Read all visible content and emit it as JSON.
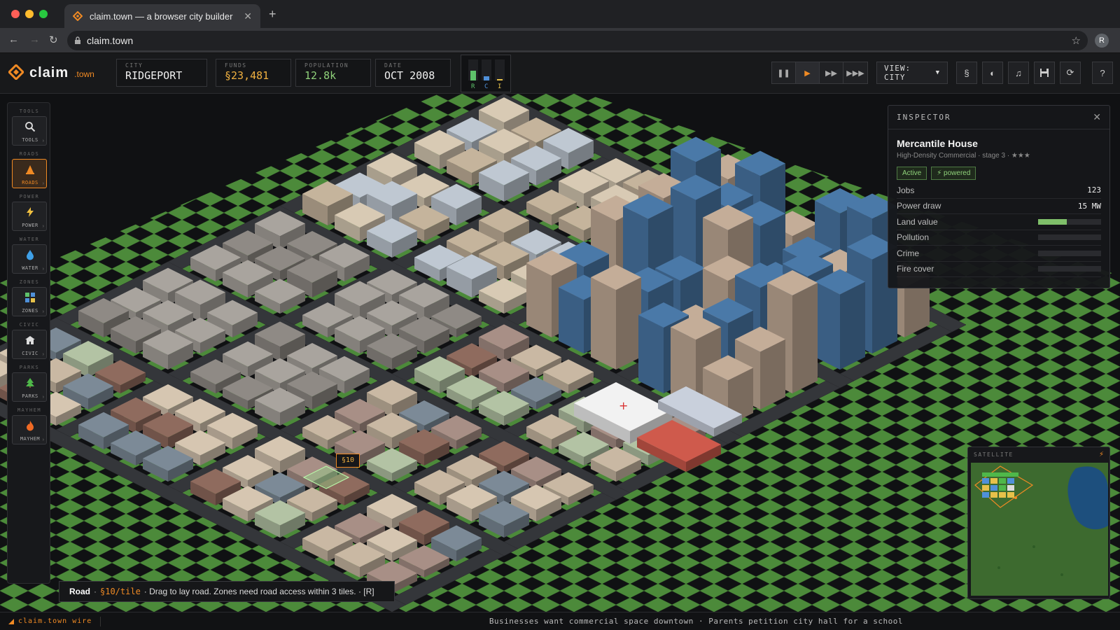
{
  "browser": {
    "tab_title": "claim.town — a browser city builder",
    "url": "claim.town",
    "profile_initial": "R"
  },
  "game": {
    "logo_name": "claim",
    "logo_tld": ".town",
    "city": {
      "label": "CITY",
      "value": "RIDGEPORT"
    },
    "funds": {
      "label": "FUNDS",
      "value": "§23,481"
    },
    "population": {
      "label": "POPULATION",
      "value": "12.8k"
    },
    "date": {
      "label": "DATE",
      "value": "OCT 2008"
    },
    "rci": {
      "r_label": "R",
      "c_label": "C",
      "i_label": "I",
      "r_demand": 0.45,
      "c_demand": 0.2,
      "i_demand": 0.05
    },
    "view_label": "VIEW: CITY",
    "accent_color": "#f08a24"
  },
  "tools": [
    {
      "group": "TOOLS",
      "label": "TOOLS",
      "icon": "magnifier-icon"
    },
    {
      "group": "ROADS",
      "label": "ROADS",
      "icon": "road-cone-icon",
      "active": true
    },
    {
      "group": "POWER",
      "label": "POWER",
      "icon": "lightning-icon"
    },
    {
      "group": "WATER",
      "label": "WATER",
      "icon": "water-drop-icon"
    },
    {
      "group": "ZONES",
      "label": "ZONES",
      "icon": "zones-grid-icon"
    },
    {
      "group": "CIVIC",
      "label": "CIVIC",
      "icon": "civic-building-icon"
    },
    {
      "group": "PARKS",
      "label": "PARKS",
      "icon": "tree-icon"
    },
    {
      "group": "MAYHEM",
      "label": "MAYHEM",
      "icon": "fire-icon"
    }
  ],
  "inspector": {
    "title": "INSPECTOR",
    "building": "Mercantile House",
    "subtitle": "High-Density Commercial · stage 3 · ★★★",
    "status": "Active",
    "power_status": "⚡ powered",
    "rows": [
      {
        "key": "Jobs",
        "value": "123"
      },
      {
        "key": "Power draw",
        "value": "15 MW"
      },
      {
        "key": "Land value",
        "level": 0.45
      },
      {
        "key": "Pollution",
        "level": 0
      },
      {
        "key": "Crime",
        "level": 0
      },
      {
        "key": "Fire cover",
        "level": 0
      }
    ]
  },
  "minimap": {
    "title": "SATELLITE"
  },
  "hint": {
    "tool": "Road",
    "cost": "§10/tile",
    "text": "· Drag to lay road. Zones need road access within 3 tiles. · [R]"
  },
  "cursor_price": "§10",
  "ticker": {
    "brand": "claim.town wire",
    "message": "Businesses want commercial space downtown · Parents petition city hall for a school"
  }
}
